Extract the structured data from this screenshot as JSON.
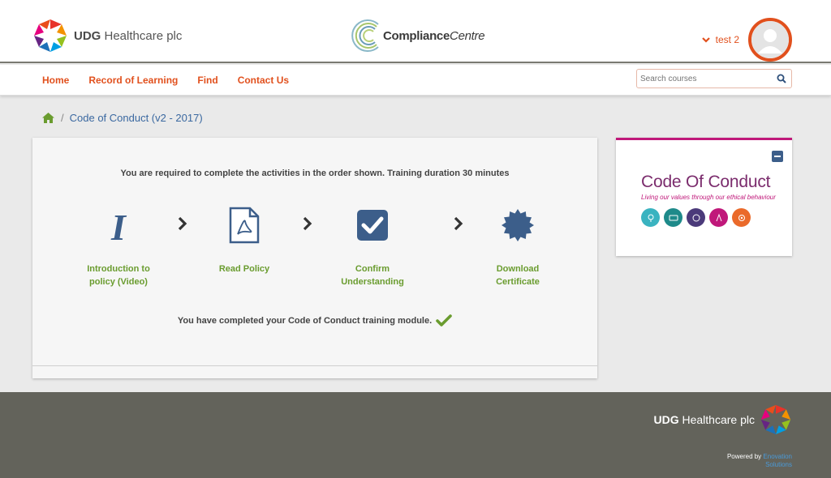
{
  "header": {
    "brand_bold": "UDG",
    "brand_rest": " Healthcare plc",
    "cc_bold": "Compliance",
    "cc_italic": "Centre",
    "user_name": "test 2"
  },
  "nav": {
    "items": [
      {
        "label": "Home"
      },
      {
        "label": "Record of Learning"
      },
      {
        "label": "Find"
      },
      {
        "label": "Contact Us"
      }
    ],
    "search_placeholder": "Search courses"
  },
  "breadcrumb": {
    "separator": "/",
    "current": "Code of Conduct (v2 - 2017)"
  },
  "course": {
    "instructions": "You are required to complete the activities in the order shown. Training duration 30 minutes",
    "steps": [
      {
        "line1": "Introduction to",
        "line2": "policy (Video)",
        "icon": "italic-i-icon"
      },
      {
        "line1": "Read Policy",
        "line2": "",
        "icon": "pdf-document-icon"
      },
      {
        "line1": "Confirm",
        "line2": "Understanding",
        "icon": "checkbox-icon"
      },
      {
        "line1": "Download",
        "line2": "Certificate",
        "icon": "certificate-badge-icon"
      }
    ],
    "completed_text": "You have completed your Code of Conduct training module."
  },
  "side": {
    "title": "Code Of Conduct",
    "subtitle": "Living our values through our ethical behaviour",
    "circle_colors": [
      "#3ab3c0",
      "#1e8a8a",
      "#4b3a7a",
      "#c0187a",
      "#ea6a2a"
    ]
  },
  "footer": {
    "brand_bold": "UDG",
    "brand_rest": " Healthcare plc",
    "powered_prefix": "Powered by ",
    "powered_link1": "Enovation",
    "powered_link2": "Solutions"
  },
  "colors": {
    "accent": "#e1501d",
    "icon_blue": "#3c5e8a",
    "step_green": "#6a9c2f",
    "footer_bg": "#63635b"
  }
}
